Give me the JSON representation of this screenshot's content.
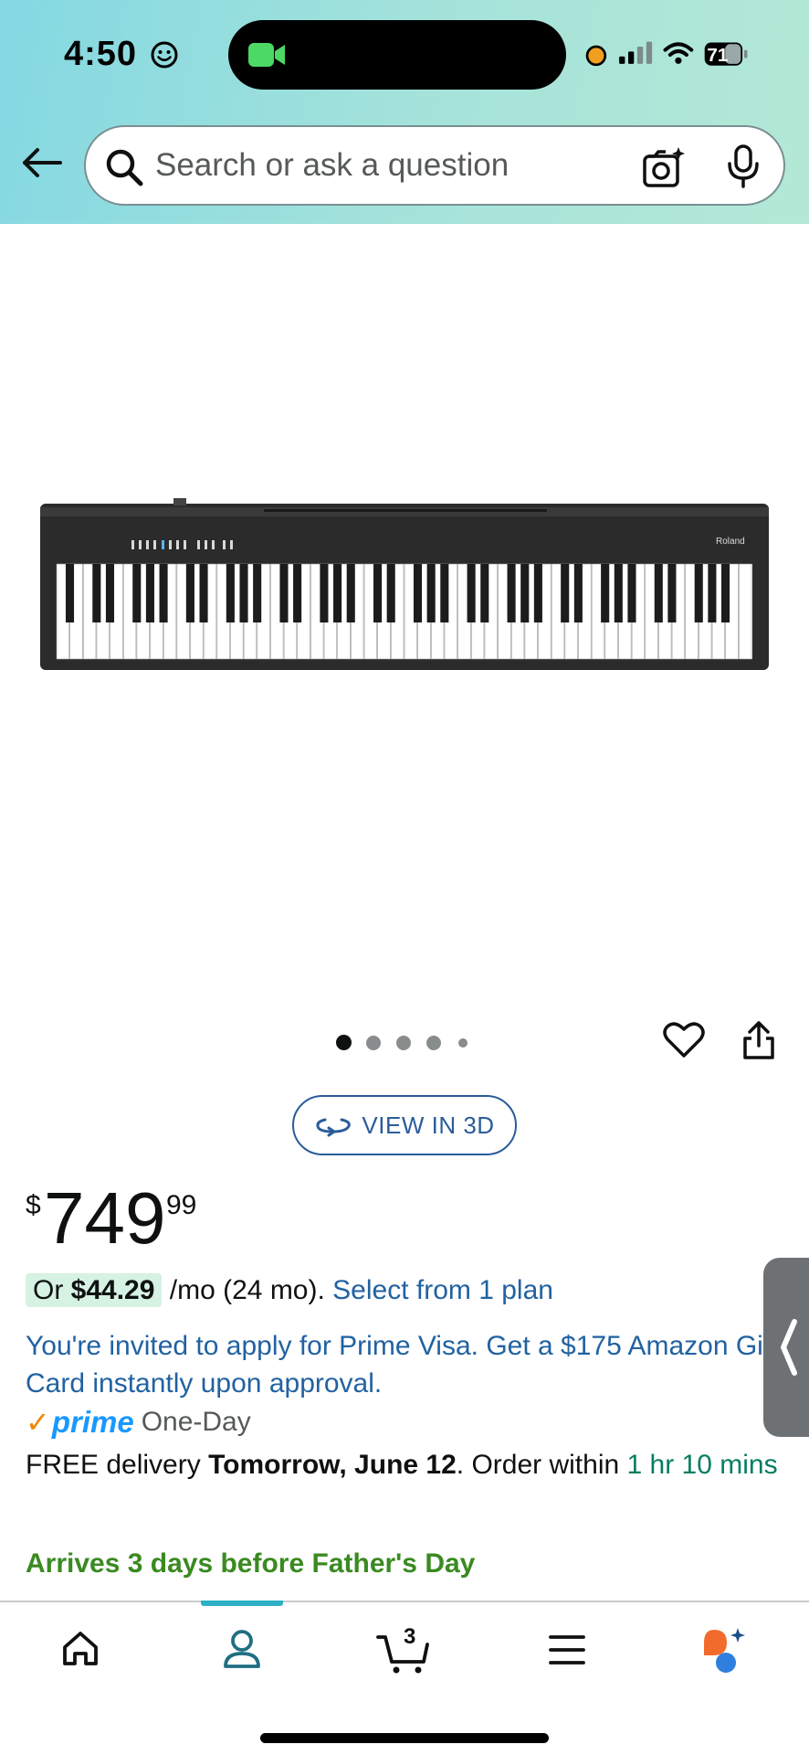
{
  "status_bar": {
    "time": "4:50",
    "battery": "71"
  },
  "search": {
    "placeholder": "Search or ask a question"
  },
  "product": {
    "image_alt": "Roland FP-30X digital piano",
    "carousel_dots": 5,
    "carousel_active": 1,
    "view_3d_label": "VIEW IN 3D",
    "price": {
      "symbol": "$",
      "whole": "749",
      "fraction": "99"
    },
    "installment": {
      "prefix": "Or",
      "amount": "$44.29",
      "terms": "/mo (24 mo).",
      "link": "Select from 1 plan"
    },
    "prime_visa_offer": "You're invited to apply for Prime Visa. Get a $175 Amazon Gift Card instantly upon approval.",
    "prime": {
      "check": "✓",
      "word": "prime",
      "service": "One-Day"
    },
    "delivery": {
      "prefix": "FREE delivery",
      "date": "Tomorrow, June 12",
      "middle": ". Order within",
      "countdown": "1 hr 10 mins"
    },
    "arrives_note": "Arrives 3 days before Father's Day"
  },
  "bottom_nav": {
    "cart_count": "3",
    "active_tab": "account"
  },
  "colors": {
    "link": "#2162a1",
    "prime_blue": "#1a98ff",
    "countdown_green": "#067d62",
    "arrives_green": "#3a8a21",
    "installment_bg": "#d5f2e2",
    "nav_accent": "#2db0c4"
  }
}
